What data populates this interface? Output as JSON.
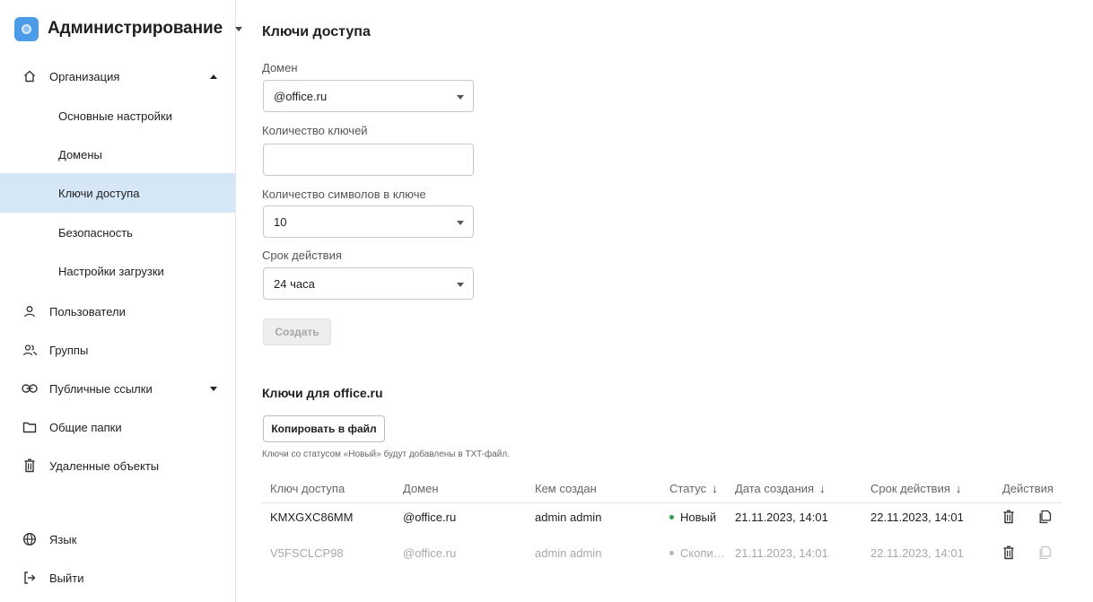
{
  "sidebar": {
    "title": "Администрирование",
    "items": [
      {
        "label": "Организация"
      },
      {
        "label": "Основные настройки"
      },
      {
        "label": "Домены"
      },
      {
        "label": "Ключи доступа"
      },
      {
        "label": "Безопасность"
      },
      {
        "label": "Настройки загрузки"
      },
      {
        "label": "Пользователи"
      },
      {
        "label": "Группы"
      },
      {
        "label": "Публичные ссылки"
      },
      {
        "label": "Общие папки"
      },
      {
        "label": "Удаленные объекты"
      },
      {
        "label": "Язык"
      },
      {
        "label": "Выйти"
      }
    ],
    "active_index": 3,
    "active_color": "#d5e6f7"
  },
  "main": {
    "title": "Ключи доступа",
    "form": {
      "domain_label": "Домен",
      "domain_value": "@office.ru",
      "count_label": "Количество ключей",
      "count_value": "",
      "length_label": "Количество символов в ключе",
      "length_value": "10",
      "validity_label": "Срок действия",
      "validity_value": "24 часа",
      "create_button": "Создать"
    },
    "keys_section": {
      "title": "Ключи для office.ru",
      "copy_button": "Копировать в файл",
      "hint": "Ключи со статусом «Новый» будут добавлены в TXT-файл."
    },
    "table": {
      "columns": [
        "Ключ доступа",
        "Домен",
        "Кем создан",
        "Статус",
        "Дата создания",
        "Срок действия",
        "Действия"
      ],
      "rows": [
        {
          "key": "KMXGXC86MM",
          "domain": "@office.ru",
          "creator": "admin admin",
          "status": "Новый",
          "created": "21.11.2023, 14:01",
          "expires": "22.11.2023, 14:01",
          "status_color": "#2e9e4f",
          "dimmed": false
        },
        {
          "key": "V5FSCLCP98",
          "domain": "@office.ru",
          "creator": "admin admin",
          "status": "Скопи…",
          "created": "21.11.2023, 14:01",
          "expires": "22.11.2023, 14:01",
          "status_color": "#b5b5b5",
          "dimmed": true
        }
      ]
    }
  },
  "icons": {
    "brand": "app-logo-icon",
    "organization": "home-icon",
    "users": "user-icon",
    "groups": "users-icon",
    "links": "link-icon",
    "folders": "folder-icon",
    "trash": "trash-icon",
    "language": "globe-icon",
    "logout": "logout-icon",
    "delete": "trash-icon",
    "copy": "copy-icon"
  }
}
